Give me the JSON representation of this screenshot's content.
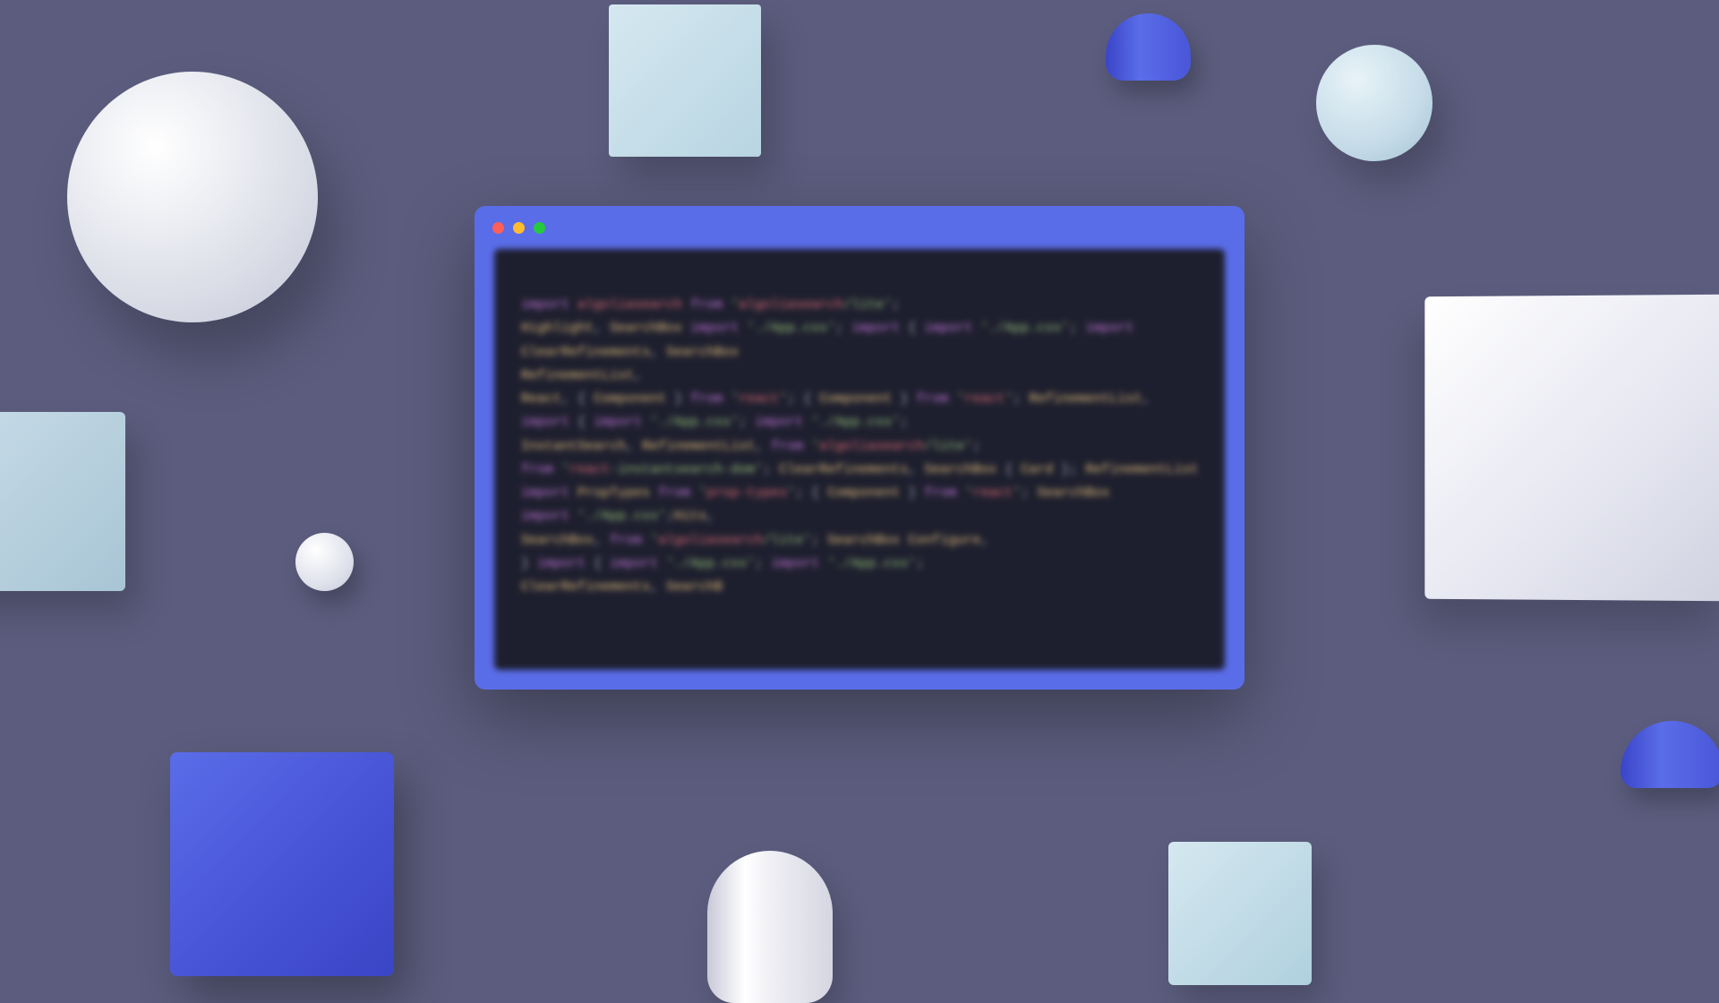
{
  "description": "3D rendered illustration of a stylized code editor window surrounded by floating geometric shapes (spheres, cubes, cylinders) on a muted purple-blue background. The code content is intentionally blurred/out-of-focus and not legible as real text.",
  "background_color": "#5c5d7e",
  "window": {
    "frame_color": "#5a6de8",
    "editor_bg": "#1e1f2e",
    "traffic_lights": [
      "close",
      "minimize",
      "maximize"
    ]
  },
  "code_blurred": true,
  "code_tokens_approx": [
    "import algoliasearch from 'algoliasearch/lite';",
    "Highlight, SearchBox import './App.css'; import { import './App.css'; import",
    "ClearRefinements, SearchBox",
    "RefinementList,",
    "React, { Component } from 'react'; { Component } from 'react'; RefinementList,",
    "import { import './App.css'; import './App.css';",
    "InstantSearch, RefinementList, from 'algoliasearch/lite';",
    "from 'react-instantsearch-dom'; ClearRefinements, SearchBox { Card }; RefinementList,",
    "import PropTypes from 'prop-types'; { Component } from 'react'; SearchBox",
    "import './App.css';Hits,",
    "SearchBox, from 'algoliasearch/lite'; SearchBox Configure,",
    "} import { import './App.css'; import './App.css';",
    "ClearRefinements, SearchB"
  ],
  "shapes": [
    {
      "type": "sphere",
      "color": "white",
      "position": "top-left",
      "size": "large"
    },
    {
      "type": "cube",
      "color": "light-blue",
      "position": "top-center"
    },
    {
      "type": "cylinder",
      "color": "blue",
      "position": "top-right"
    },
    {
      "type": "sphere",
      "color": "light-blue",
      "position": "top-right"
    },
    {
      "type": "cube",
      "color": "light-blue",
      "position": "left-edge"
    },
    {
      "type": "sphere",
      "color": "white",
      "position": "mid-left",
      "size": "small"
    },
    {
      "type": "cube",
      "color": "white",
      "position": "right",
      "size": "large"
    },
    {
      "type": "cube",
      "color": "blue",
      "position": "bottom-left"
    },
    {
      "type": "cylinder",
      "color": "white",
      "position": "bottom-center"
    },
    {
      "type": "cube",
      "color": "light-blue",
      "position": "bottom-right"
    },
    {
      "type": "cylinder",
      "color": "blue",
      "position": "right-edge"
    }
  ]
}
